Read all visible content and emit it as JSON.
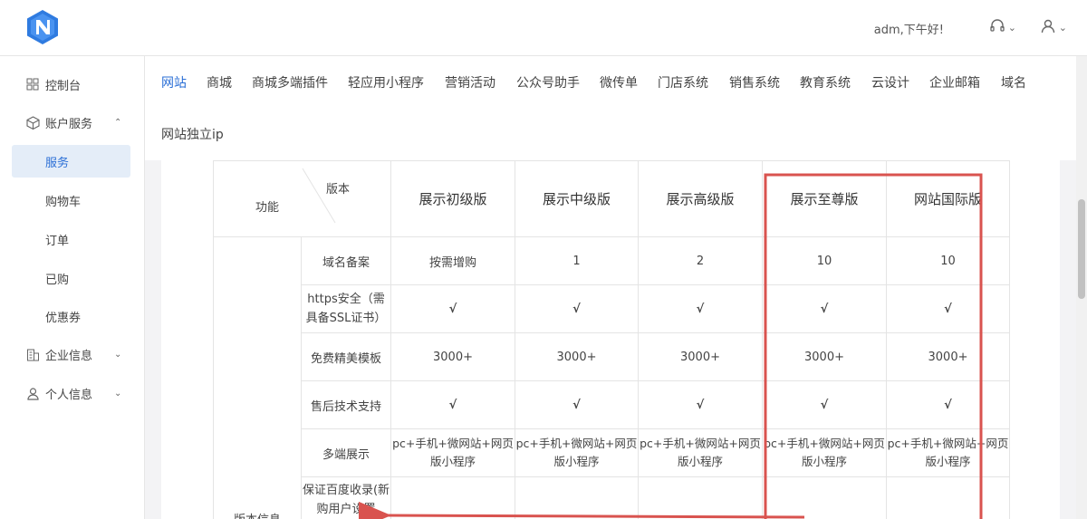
{
  "header": {
    "greeting": "adm,下午好!",
    "service_icon": "headset-icon",
    "user_icon": "user-icon",
    "accent": "#2b6fd6"
  },
  "sidebar": {
    "items": [
      {
        "label": "控制台",
        "icon": "dashboard-icon"
      },
      {
        "label": "账户服务",
        "icon": "box-icon"
      },
      {
        "label": "服务"
      },
      {
        "label": "购物车"
      },
      {
        "label": "订单"
      },
      {
        "label": "已购"
      },
      {
        "label": "优惠券"
      },
      {
        "label": "企业信息",
        "icon": "building-icon"
      },
      {
        "label": "个人信息",
        "icon": "person-icon"
      }
    ]
  },
  "tabs": [
    "网站",
    "商城",
    "商城多端插件",
    "轻应用小程序",
    "营销活动",
    "公众号助手",
    "微传单",
    "门店系统",
    "销售系统",
    "教育系统",
    "云设计",
    "企业邮箱",
    "域名",
    "网站独立ip"
  ],
  "table": {
    "corner_version": "版本",
    "corner_feature": "功能",
    "group_label": "版本信息",
    "columns": [
      "展示初级版",
      "展示中级版",
      "展示高级版",
      "展示至尊版",
      "网站国际版"
    ],
    "rows": [
      {
        "feature": "域名备案",
        "values": [
          "按需增购",
          "1",
          "2",
          "10",
          "10"
        ]
      },
      {
        "feature": "https安全（需具备SSL证书）",
        "values": [
          "√",
          "√",
          "√",
          "√",
          "√"
        ]
      },
      {
        "feature": "免费精美模板",
        "values": [
          "3000+",
          "3000+",
          "3000+",
          "3000+",
          "3000+"
        ]
      },
      {
        "feature": "售后技术支持",
        "values": [
          "√",
          "√",
          "√",
          "√",
          "√"
        ]
      },
      {
        "feature": "多端展示",
        "values": [
          "pc+手机+微网站+网页版小程序",
          "pc+手机+微网站+网页版小程序",
          "pc+手机+微网站+网页版小程序",
          "pc+手机+微网站+网页版小程序",
          "pc+手机+微网站+网页版小程序"
        ]
      },
      {
        "feature": "保证百度收录(新购用户设置",
        "values": [
          "",
          "",
          "",
          "",
          ""
        ]
      }
    ],
    "check_color": "#1a9a3c"
  },
  "annotation_color": "#d9534f"
}
